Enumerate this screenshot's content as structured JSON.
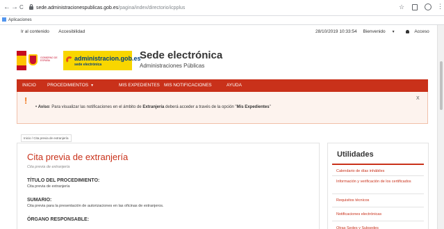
{
  "browser": {
    "back_icon": "←",
    "forward_icon": "→",
    "reload_icon": "C",
    "url_host": "sede.administracionespublicas.gob.es",
    "url_path": "/pagina/index/directorio/icpplus",
    "star_icon": "☆",
    "bookmarks_label": "Aplicaciones"
  },
  "topbar": {
    "skip_link": "Ir al contenido",
    "accessibility_link": "Accesibilidad",
    "datetime": "28/10/2019 10:33:54",
    "welcome": "Bienvenido",
    "access": "Acceso"
  },
  "header": {
    "gov_text": "GOBIERNO DE ESPAÑA",
    "adm_title": "administracion.gob.es",
    "adm_sub": "sede electrónica",
    "title": "Sede electrónica",
    "subtitle": "Administraciones Públicas"
  },
  "nav": {
    "items": [
      "INICIO",
      "PROCEDIMIENTOS",
      "MIS EXPEDIENTES",
      "MIS NOTIFICACIONES",
      "AYUDA"
    ]
  },
  "alert": {
    "mark": "!",
    "bullet": "•",
    "label": "Aviso",
    "text_1": ": Para visualizar las notificaciones en el ámbito de ",
    "bold_1": "Extranjería",
    "text_2": " deberá acceder a través de la opción \"",
    "bold_2": "Mis Expedientes",
    "text_3": "\"",
    "close": "X"
  },
  "breadcrumb": "Inicio / Cita previa de extranjería",
  "main": {
    "title": "Cita previa de extranjería",
    "subtitle": "Cita previa de extranjería",
    "sections": [
      {
        "heading": "TÍTULO DEL PROCEDIMIENTO:",
        "text": "Cita previa de extranjería"
      },
      {
        "heading": "SUMARIO:",
        "text": "Cita previa para la presentación de autorizaciones en las oficinas de extranjeros."
      },
      {
        "heading": "ÓRGANO RESPONSABLE:",
        "text": ""
      }
    ]
  },
  "sidebar": {
    "heading": "Utilidades",
    "items": [
      "Calendario de días inhábiles",
      "Información y verificación de los certificados",
      "Requisitos técnicos",
      "Notificaciones electrónicas",
      "Otras Sedes y Subsedes"
    ]
  },
  "colors": {
    "brand_red": "#c9311a",
    "alert_orange": "#f0781e",
    "adm_yellow": "#f8d600"
  }
}
